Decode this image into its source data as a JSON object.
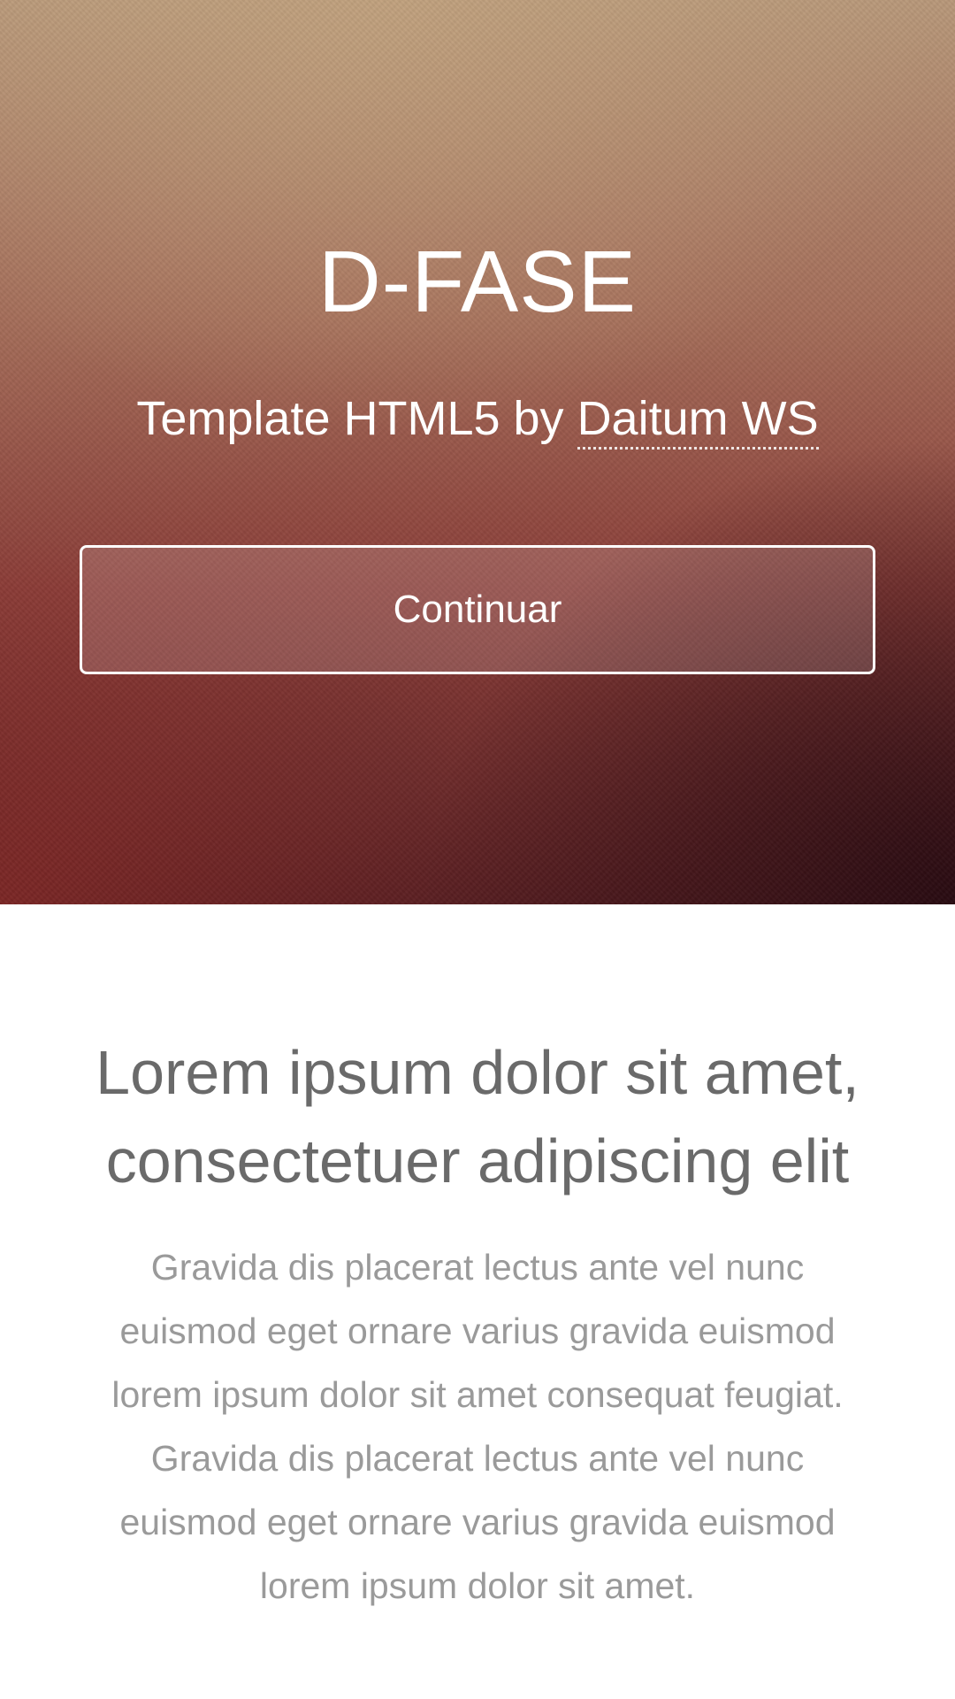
{
  "hero": {
    "title": "D-FASE",
    "subtitle_prefix": "Template HTML5 by ",
    "author_link": "Daitum WS",
    "button_label": "Continuar"
  },
  "content": {
    "heading_line1": "Lorem ipsum dolor sit amet,",
    "heading_line2": "consectetuer adipiscing elit",
    "body_lines": [
      "Gravida dis placerat lectus ante vel nunc",
      "euismod eget ornare varius gravida euismod",
      "lorem ipsum dolor sit amet consequat feugiat.",
      "Gravida dis placerat lectus ante vel nunc",
      "euismod eget ornare varius gravida euismod",
      "lorem ipsum dolor sit amet."
    ]
  },
  "colors": {
    "hero_top": "#b8987a",
    "hero_bottom": "#5a1f22",
    "heading_text": "#6a6a6a",
    "body_text": "#9a9a9a"
  }
}
